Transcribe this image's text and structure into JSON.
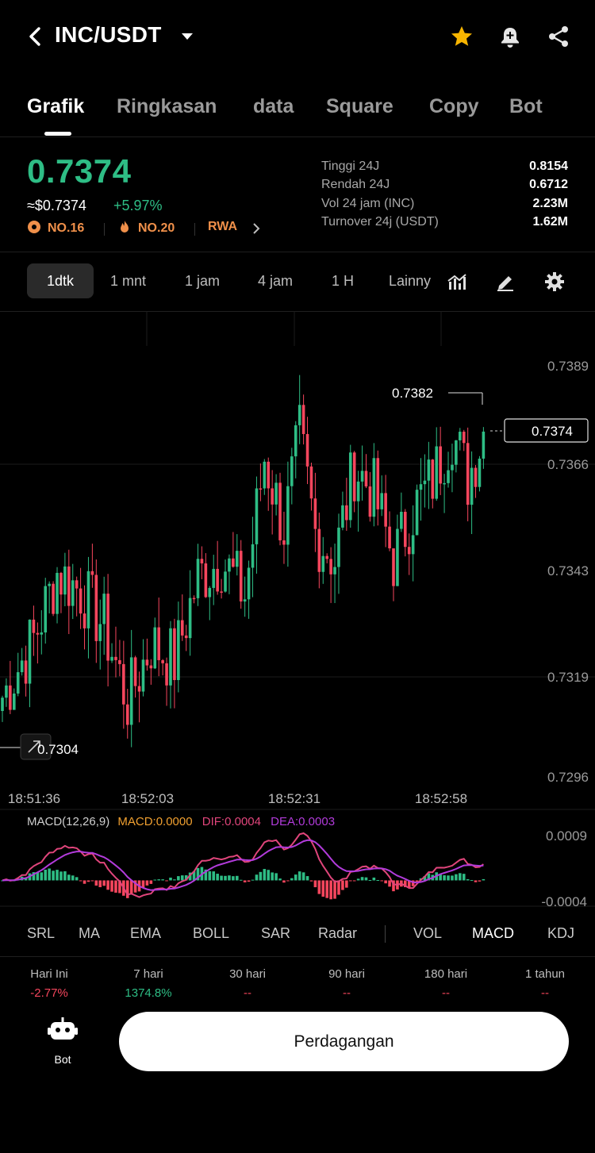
{
  "header": {
    "pair": "INC/USDT",
    "icons": [
      "back-icon",
      "chevron-down-icon",
      "star-icon",
      "bell-plus-icon",
      "share-icon"
    ],
    "star_color": "#f7b500"
  },
  "tabs": [
    "Grafik",
    "Ringkasan",
    "data",
    "Square",
    "Copy",
    "Bot"
  ],
  "active_tab": "Grafik",
  "price": {
    "last": "0.7374",
    "usd": "≈$0.7374",
    "change": "+5.97%",
    "rank1": "NO.16",
    "rank2": "NO.20",
    "tag": "RWA",
    "up_color": "#2ebd85",
    "down_color": "#f6465d"
  },
  "stats": [
    {
      "label": "Tinggi 24J",
      "value": "0.8154"
    },
    {
      "label": "Rendah 24J",
      "value": "0.6712"
    },
    {
      "label": "Vol 24 jam (INC)",
      "value": "2.23M"
    },
    {
      "label": "Turnover 24j (USDT)",
      "value": "1.62M"
    }
  ],
  "intervals": [
    "1dtk",
    "1 mnt",
    "1 jam",
    "4 jam",
    "1 H",
    "Lainny"
  ],
  "active_interval": "1dtk",
  "chart": {
    "price_ticks": [
      "0.7389",
      "0.7366",
      "0.7343",
      "0.7319",
      "0.7296"
    ],
    "time_ticks": [
      "18:51:36",
      "18:52:03",
      "18:52:31",
      "18:52:58"
    ],
    "high_label": "0.7382",
    "low_label": "0.7304",
    "current_label": "0.7374",
    "macd_header": "MACD(12,26,9)",
    "macd_value": "MACD:0.0000",
    "dif_value": "DIF:0.0004",
    "dea_value": "DEA:0.0003",
    "macd_ticks": [
      "0.0009",
      "-0.0004"
    ]
  },
  "chart_data": {
    "type": "candlestick",
    "x": [
      "18:51:36",
      "18:52:03",
      "18:52:31",
      "18:52:58"
    ],
    "y_ticks": [
      0.7389,
      0.7366,
      0.7343,
      0.7319,
      0.7296
    ],
    "ylim": [
      0.7296,
      0.7389
    ],
    "visible_high": 0.7382,
    "visible_low": 0.7304,
    "last": 0.7374,
    "series": [
      {
        "name": "MACD",
        "value": 0.0
      },
      {
        "name": "DIF",
        "value": 0.0004
      },
      {
        "name": "DEA",
        "value": 0.0003
      }
    ],
    "macd_ylim": [
      -0.0004,
      0.0009
    ]
  },
  "indicators": [
    "SRL",
    "MA",
    "EMA",
    "BOLL",
    "SAR",
    "Radar",
    "VOL",
    "MACD",
    "KDJ"
  ],
  "active_indicator": "MACD",
  "performance": [
    {
      "label": "Hari Ini",
      "value": "-2.77%",
      "color": "#f6465d"
    },
    {
      "label": "7 hari",
      "value": "1374.8%",
      "color": "#2ebd85"
    },
    {
      "label": "30 hari",
      "value": "--",
      "color": "#f6465d"
    },
    {
      "label": "90 hari",
      "value": "--",
      "color": "#f6465d"
    },
    {
      "label": "180 hari",
      "value": "--",
      "color": "#f6465d"
    },
    {
      "label": "1 tahun",
      "value": "--",
      "color": "#f6465d"
    }
  ],
  "bottom": {
    "bot_label": "Bot",
    "trade_label": "Perdagangan"
  }
}
